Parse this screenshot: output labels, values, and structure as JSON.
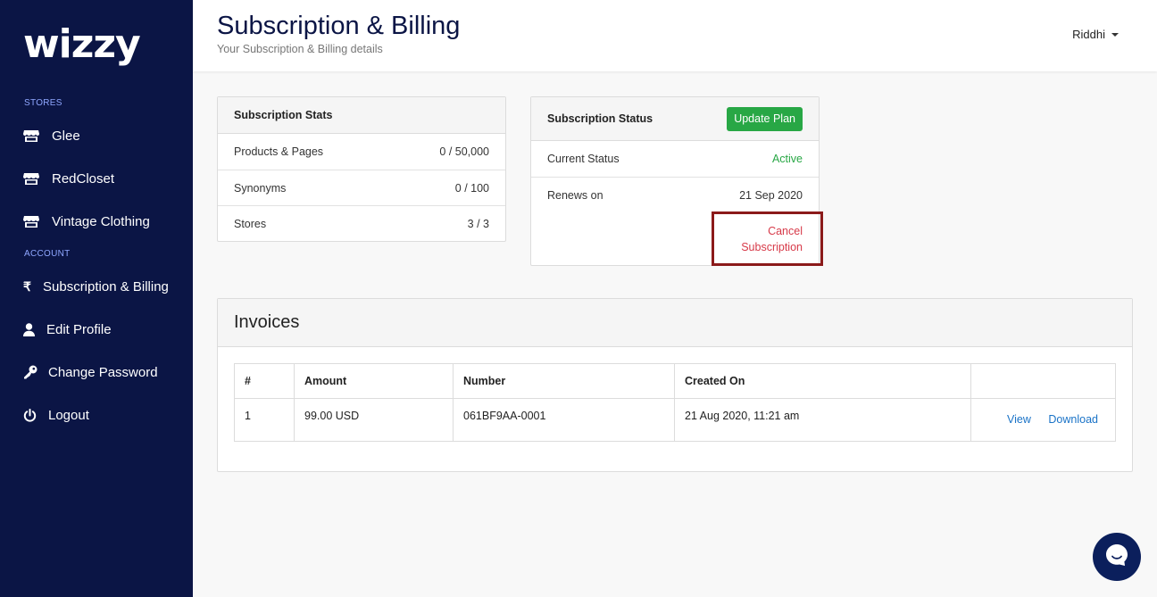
{
  "brand": {
    "logo_text": "wizzy"
  },
  "sidebar": {
    "stores_label": "STORES",
    "stores": [
      {
        "label": "Glee",
        "icon": "store-icon"
      },
      {
        "label": "RedCloset",
        "icon": "store-icon"
      },
      {
        "label": "Vintage Clothing",
        "icon": "store-icon"
      }
    ],
    "account_label": "ACCOUNT",
    "account": [
      {
        "label": "Subscription & Billing",
        "icon": "rupee-icon"
      },
      {
        "label": "Edit Profile",
        "icon": "user-icon"
      },
      {
        "label": "Change Password",
        "icon": "key-icon"
      },
      {
        "label": "Logout",
        "icon": "power-icon"
      }
    ]
  },
  "header": {
    "title": "Subscription & Billing",
    "subtitle": "Your Subscription & Billing details",
    "user_name": "Riddhi"
  },
  "subscription_stats": {
    "title": "Subscription Stats",
    "rows": [
      {
        "label": "Products & Pages",
        "value": "0 / 50,000"
      },
      {
        "label": "Synonyms",
        "value": "0 / 100"
      },
      {
        "label": "Stores",
        "value": "3 / 3"
      }
    ]
  },
  "subscription_status": {
    "title": "Subscription Status",
    "update_button": "Update Plan",
    "current_status_label": "Current Status",
    "current_status_value": "Active",
    "renews_label": "Renews on",
    "renews_value": "21 Sep 2020",
    "cancel_line1": "Cancel",
    "cancel_line2": "Subscription"
  },
  "invoices": {
    "title": "Invoices",
    "columns": [
      "#",
      "Amount",
      "Number",
      "Created On",
      ""
    ],
    "rows": [
      {
        "index": "1",
        "amount": "99.00 USD",
        "number": "061BF9AA-0001",
        "created_on": "21 Aug 2020, 11:21 am",
        "view_label": "View",
        "download_label": "Download"
      }
    ]
  },
  "colors": {
    "sidebar_bg": "#0b1545",
    "accent_green": "#28a745",
    "danger_red": "#d73a49",
    "highlight_border": "#8b1a1a",
    "link_blue": "#1a73c7"
  }
}
